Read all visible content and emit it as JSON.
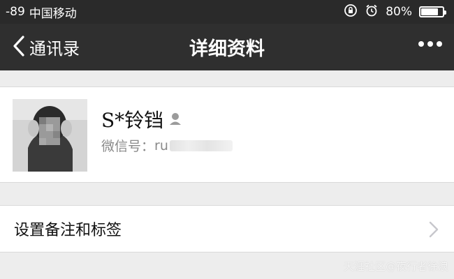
{
  "status_bar": {
    "signal": "-89",
    "carrier": "中国移动",
    "battery_percent": "80%",
    "battery_level": 0.8
  },
  "nav": {
    "back_label": "通讯录",
    "title": "详细资料",
    "more_icon": "more-dots-icon"
  },
  "profile": {
    "name": "S*铃铛",
    "gender_icon": "female-gender-icon",
    "wechat_id_label": "微信号：",
    "wechat_id_value": "ru"
  },
  "menu": {
    "remark_label": "设置备注和标签"
  },
  "watermark": "天涯社区@夜行者徐浪",
  "colors": {
    "nav_bg": "#2f2f2f",
    "status_bg": "#2a2a2a",
    "page_bg": "#ededed",
    "card_bg": "#ffffff",
    "secondary_text": "#8a8a8a"
  }
}
